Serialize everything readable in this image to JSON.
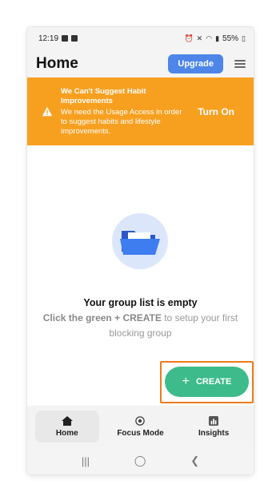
{
  "status_bar": {
    "time": "12:19",
    "battery": "55%"
  },
  "header": {
    "title": "Home",
    "upgrade_label": "Upgrade"
  },
  "banner": {
    "title": "We Can't Suggest Habit Improvements",
    "body": "We need the Usage Access in order to suggest habits and lifestyle improvements.",
    "action_label": "Turn On"
  },
  "empty_state": {
    "title": "Your group list is empty",
    "hint_prefix": "Click the green + CREATE",
    "hint_suffix": " to setup your first blocking group"
  },
  "create_button": {
    "label": "CREATE",
    "plus": "+"
  },
  "bottom_nav": {
    "items": [
      {
        "label": "Home",
        "icon": "home-icon",
        "active": true
      },
      {
        "label": "Focus Mode",
        "icon": "focus-icon",
        "active": false
      },
      {
        "label": "Insights",
        "icon": "bar-chart-icon",
        "active": false
      }
    ]
  },
  "colors": {
    "banner": "#f7a020",
    "upgrade": "#4d86e8",
    "create": "#3dbb8a",
    "highlight": "#f07a1a"
  }
}
